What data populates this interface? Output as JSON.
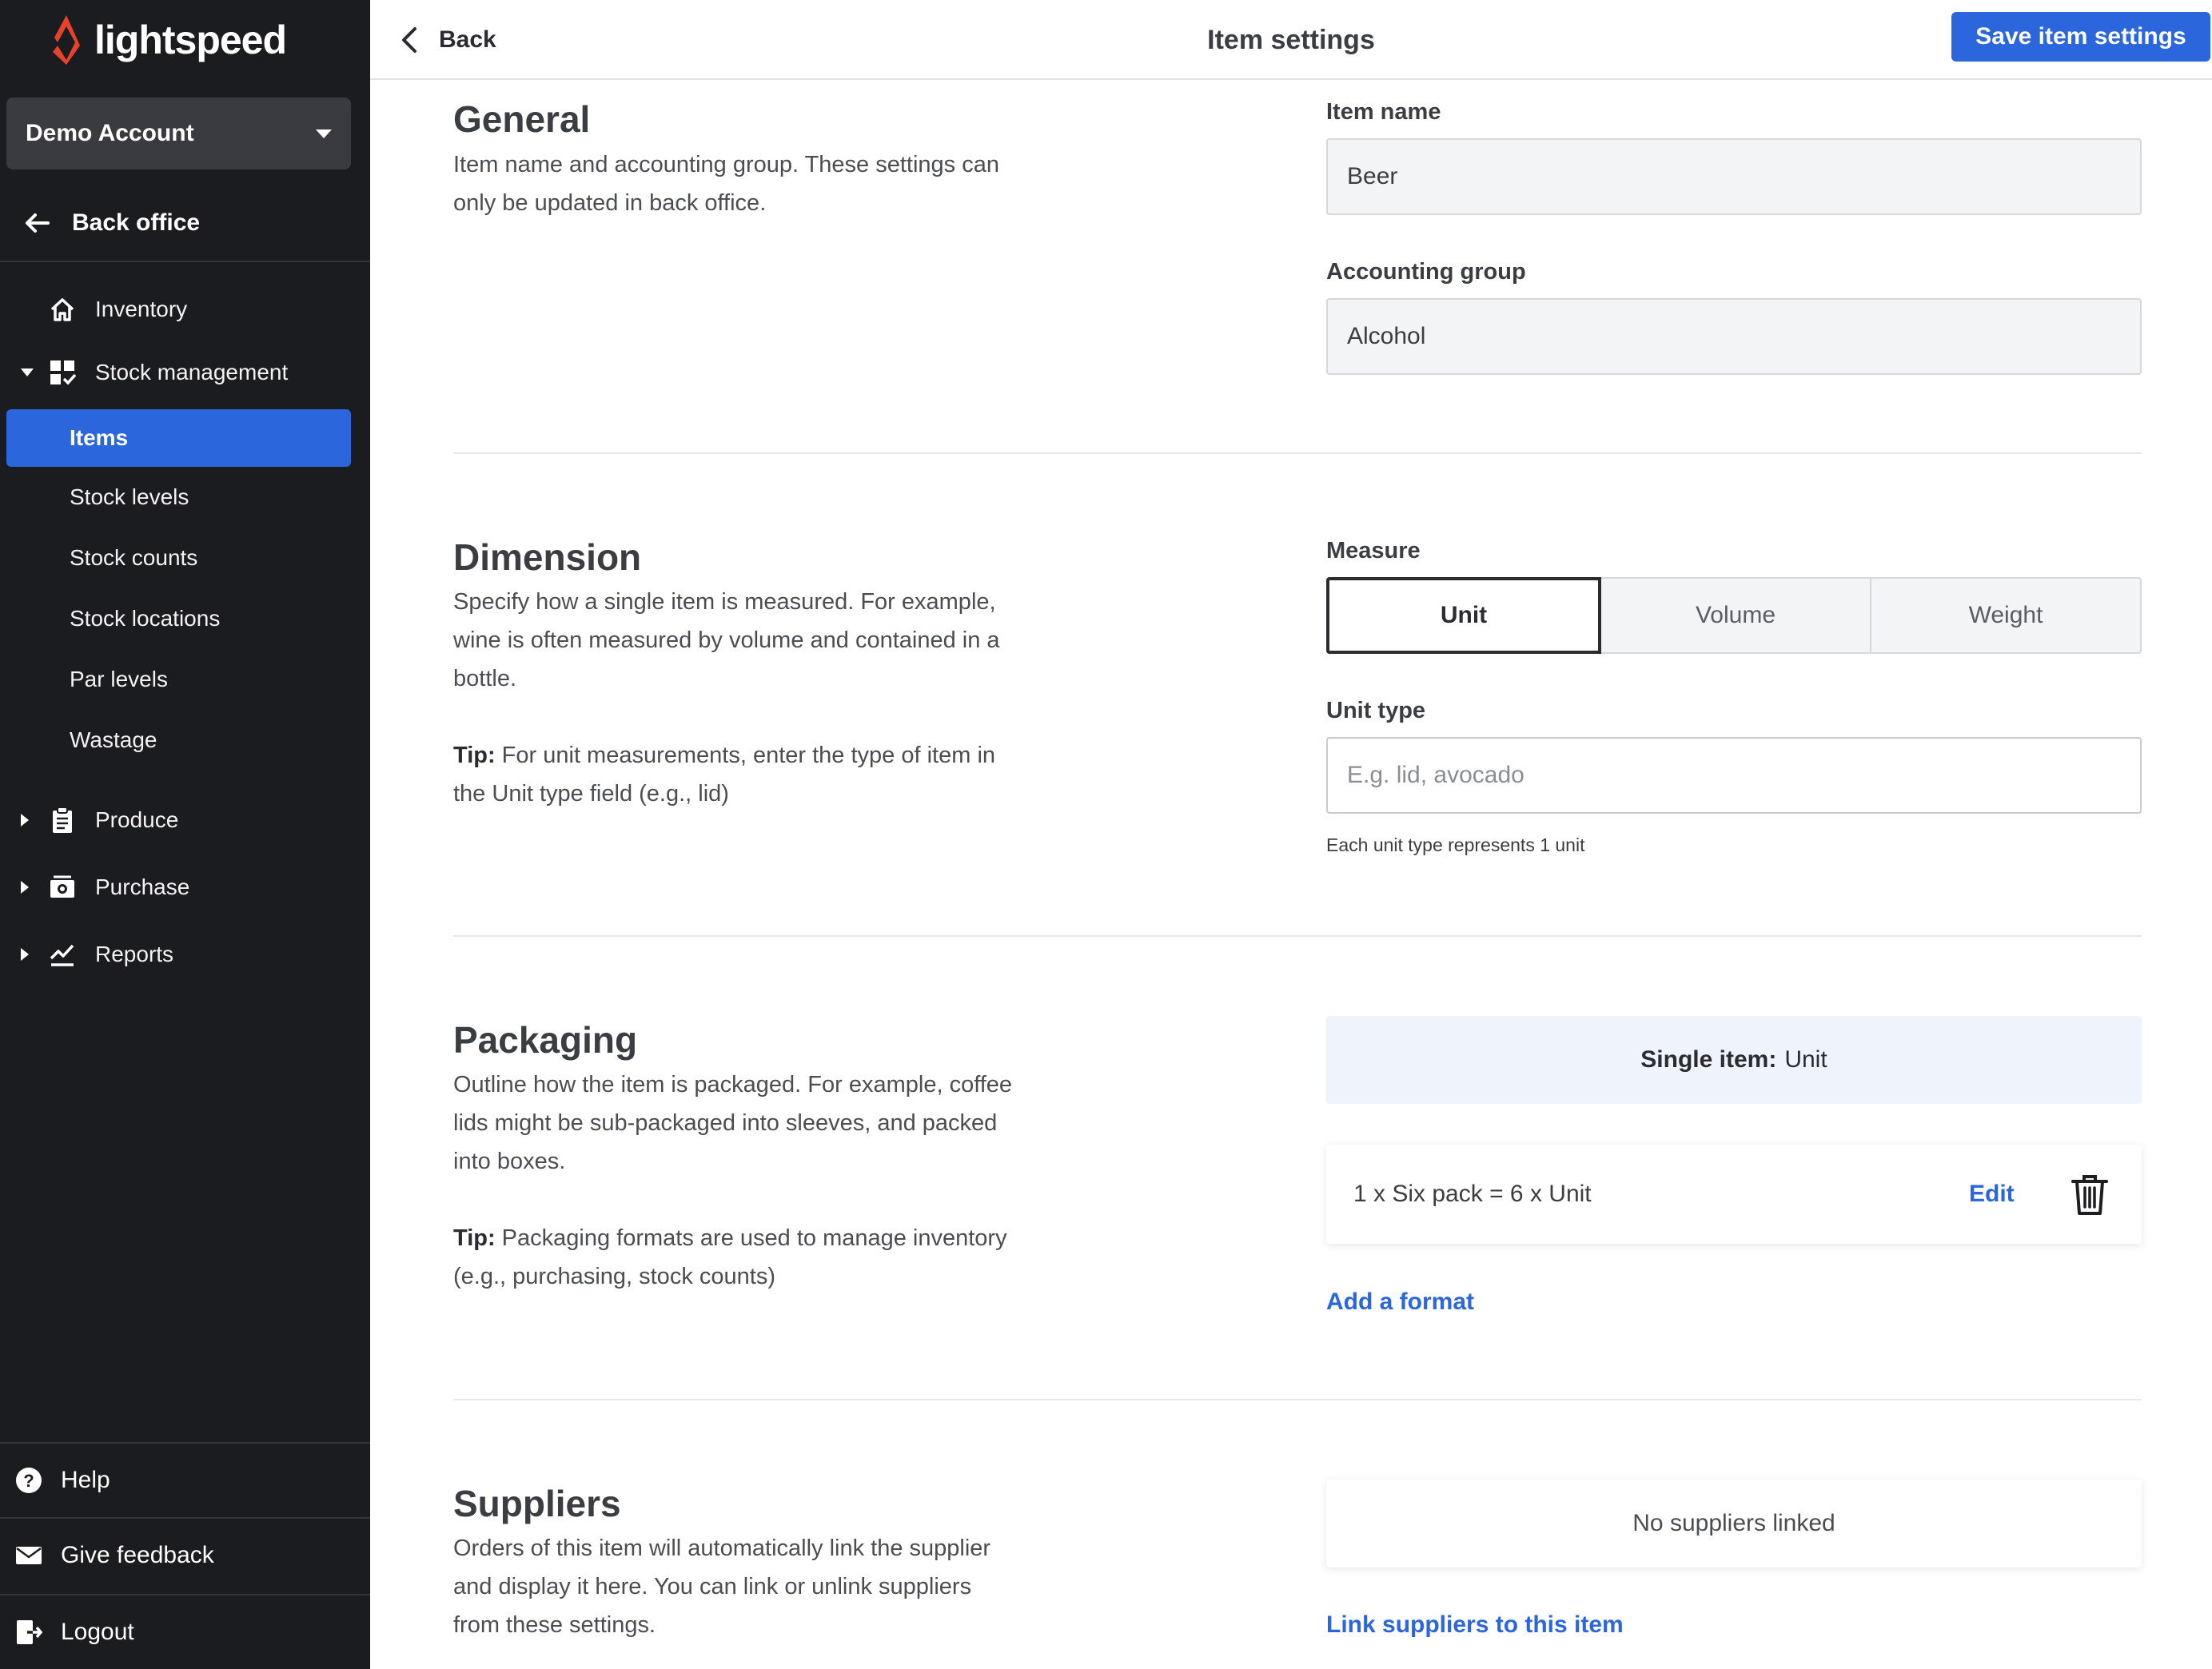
{
  "brand": {
    "logo_text": "lightspeed",
    "accent": "#2c66dd",
    "sidebar_bg": "#1b1c20"
  },
  "sidebar": {
    "account": "Demo Account",
    "back_office": "Back office",
    "items": [
      {
        "label": "Inventory",
        "icon": "home-icon"
      },
      {
        "label": "Stock management",
        "icon": "stock-management-icon",
        "expanded": true
      },
      {
        "label": "Produce",
        "icon": "clipboard-icon"
      },
      {
        "label": "Purchase",
        "icon": "purchase-icon"
      },
      {
        "label": "Reports",
        "icon": "reports-icon"
      }
    ],
    "sub_items": [
      {
        "label": "Items",
        "active": true
      },
      {
        "label": "Stock levels"
      },
      {
        "label": "Stock counts"
      },
      {
        "label": "Stock locations"
      },
      {
        "label": "Par levels"
      },
      {
        "label": "Wastage"
      }
    ],
    "bottom": [
      {
        "label": "Help",
        "icon": "help-icon"
      },
      {
        "label": "Give feedback",
        "icon": "mail-icon"
      },
      {
        "label": "Logout",
        "icon": "logout-icon"
      }
    ]
  },
  "header": {
    "back_label": "Back",
    "title": "Item settings",
    "save_label": "Save item settings"
  },
  "general": {
    "title": "General",
    "description": "Item name and accounting group. These settings can only be updated in back office.",
    "item_name_label": "Item name",
    "item_name_value": "Beer",
    "accounting_group_label": "Accounting group",
    "accounting_group_value": "Alcohol"
  },
  "dimension": {
    "title": "Dimension",
    "description": "Specify how a single item is measured. For example, wine is often measured by volume and contained in a bottle.",
    "tip_label": "Tip:",
    "tip_text": " For unit measurements, enter the type of item in the Unit type field (e.g., lid)",
    "measure_label": "Measure",
    "measure_options": [
      "Unit",
      "Volume",
      "Weight"
    ],
    "measure_selected": "Unit",
    "unit_type_label": "Unit type",
    "unit_type_placeholder": "E.g. lid, avocado",
    "unit_type_value": "",
    "unit_type_helper": "Each unit type represents 1 unit"
  },
  "packaging": {
    "title": "Packaging",
    "description": "Outline how the item is packaged. For example, coffee lids might be sub-packaged into sleeves, and packed into boxes.",
    "tip_label": "Tip:",
    "tip_text": " Packaging formats are used to manage inventory (e.g., purchasing, stock counts)",
    "single_item_label": "Single item:",
    "single_item_value": "Unit",
    "formats": [
      {
        "text": "1 x Six pack = 6 x Unit",
        "edit_label": "Edit"
      }
    ],
    "add_format_label": "Add a format"
  },
  "suppliers": {
    "title": "Suppliers",
    "description": "Orders of this item will automatically link the supplier and display it here. You can link or unlink suppliers from these settings.",
    "empty_text": "No suppliers linked",
    "link_label": "Link suppliers to this item"
  }
}
